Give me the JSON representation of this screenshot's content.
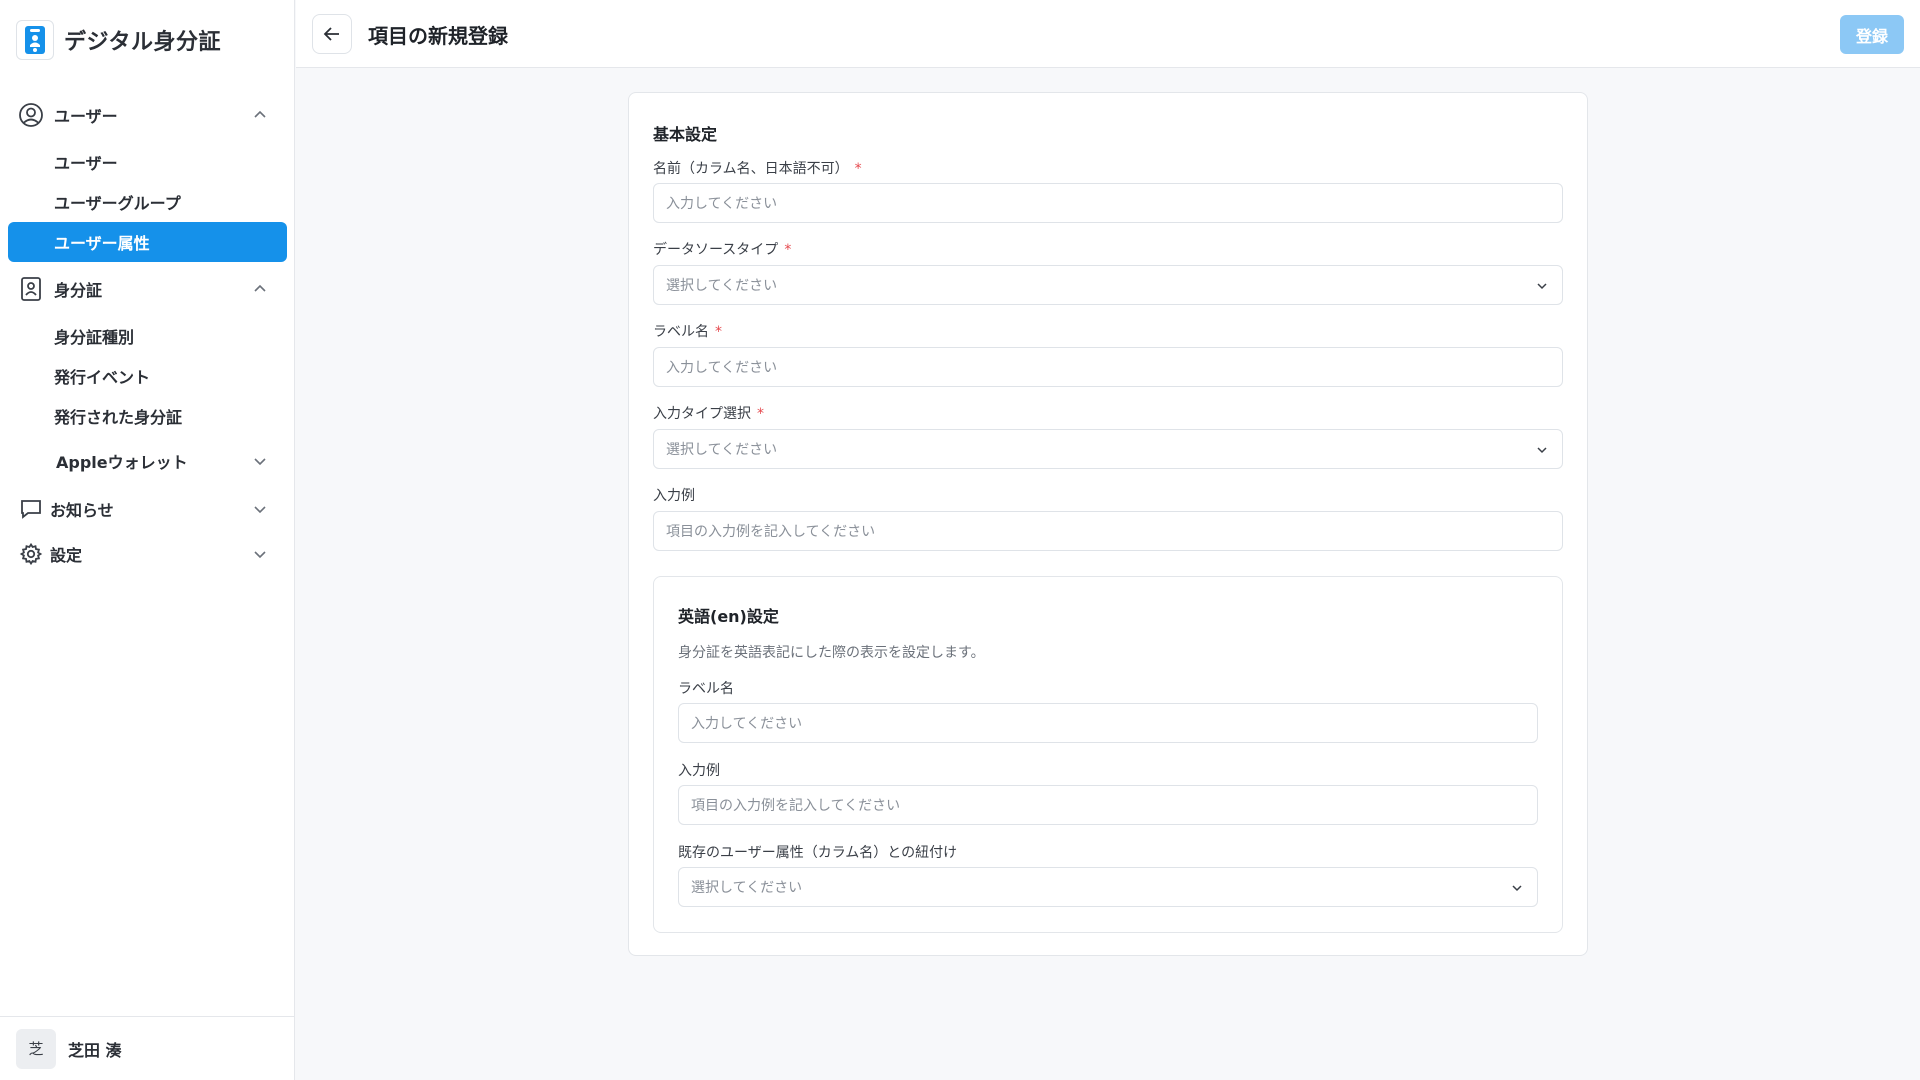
{
  "brand": {
    "title": "デジタル身分証",
    "logo_icon": "id-card-logo-icon",
    "accent": "#1591ea"
  },
  "sidebar": {
    "groups": [
      {
        "label": "ユーザー",
        "icon": "user-circle-icon",
        "expanded": true,
        "items": [
          {
            "label": "ユーザー"
          },
          {
            "label": "ユーザーグループ"
          },
          {
            "label": "ユーザー属性",
            "active": true
          }
        ]
      },
      {
        "label": "身分証",
        "icon": "id-badge-icon",
        "expanded": true,
        "items": [
          {
            "label": "身分証種別"
          },
          {
            "label": "発行イベント"
          },
          {
            "label": "発行された身分証"
          }
        ],
        "subgroup": {
          "label": "Appleウォレット",
          "expanded": false
        }
      },
      {
        "label": "お知らせ",
        "icon": "chat-bubble-icon",
        "expanded": false
      },
      {
        "label": "設定",
        "icon": "gear-icon",
        "expanded": false
      }
    ],
    "user": {
      "avatar_text": "芝",
      "name": "芝田 湊"
    }
  },
  "header": {
    "title": "項目の新規登録",
    "submit_label": "登録",
    "submit_color": "#8cc8f5"
  },
  "form": {
    "basic": {
      "title": "基本設定",
      "fields": [
        {
          "label": "名前（カラム名、日本語不可）",
          "required": "*",
          "type": "text",
          "placeholder": "入力してください"
        },
        {
          "label": "データソースタイプ",
          "required": "*",
          "type": "select",
          "placeholder": "選択してください"
        },
        {
          "label": "ラベル名",
          "required": "*",
          "type": "text",
          "placeholder": "入力してください"
        },
        {
          "label": "入力タイプ選択",
          "required": "*",
          "type": "select",
          "placeholder": "選択してください"
        },
        {
          "label": "入力例",
          "type": "text",
          "placeholder": "項目の入力例を記入してください"
        }
      ]
    },
    "english": {
      "title": "英語(en)設定",
      "description": "身分証を英語表記にした際の表示を設定します。",
      "fields": [
        {
          "label": "ラベル名",
          "type": "text",
          "placeholder": "入力してください"
        },
        {
          "label": "入力例",
          "type": "text",
          "placeholder": "項目の入力例を記入してください"
        },
        {
          "label": "既存のユーザー属性（カラム名）との紐付け",
          "type": "select",
          "placeholder": "選択してください"
        }
      ]
    }
  }
}
